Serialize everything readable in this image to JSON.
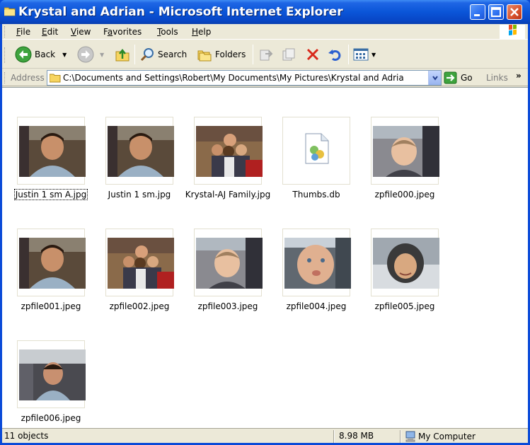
{
  "window": {
    "title": "Krystal and Adrian - Microsoft Internet Explorer"
  },
  "menu": {
    "items": [
      {
        "key": "F",
        "rest": "ile"
      },
      {
        "key": "E",
        "rest": "dit"
      },
      {
        "key": "V",
        "rest": "iew"
      },
      {
        "key": "",
        "pre": "F",
        "key2": "a",
        "rest": "vorites"
      },
      {
        "key": "T",
        "rest": "ools"
      },
      {
        "key": "H",
        "rest": "elp"
      }
    ]
  },
  "toolbar": {
    "back_label": "Back",
    "search_label": "Search",
    "folders_label": "Folders"
  },
  "address": {
    "label": "Address",
    "value": "C:\\Documents and Settings\\Robert\\My Documents\\My Pictures\\Krystal and Adria",
    "go_label": "Go",
    "links_label": "Links"
  },
  "files": [
    {
      "name": "Justin 1 sm A.jpg",
      "kind": "photo-boy"
    },
    {
      "name": "Justin 1 sm.jpg",
      "kind": "photo-boy"
    },
    {
      "name": "Krystal-AJ Family.jpg",
      "kind": "photo-family"
    },
    {
      "name": "Thumbs.db",
      "kind": "db"
    },
    {
      "name": "zpfile000.jpeg",
      "kind": "photo-baby"
    },
    {
      "name": "zpfile001.jpeg",
      "kind": "photo-boy"
    },
    {
      "name": "zpfile002.jpeg",
      "kind": "photo-family"
    },
    {
      "name": "zpfile003.jpeg",
      "kind": "photo-baby"
    },
    {
      "name": "zpfile004.jpeg",
      "kind": "photo-baby2"
    },
    {
      "name": "zpfile005.jpeg",
      "kind": "photo-hood"
    },
    {
      "name": "zpfile006.jpeg",
      "kind": "photo-car"
    }
  ],
  "status": {
    "objects": "11 objects",
    "size": "8.98 MB",
    "zone": "My Computer"
  },
  "colors": {
    "titlebar": "#0a55d8",
    "chrome": "#ece9d8",
    "selection_focus": "#000000"
  }
}
